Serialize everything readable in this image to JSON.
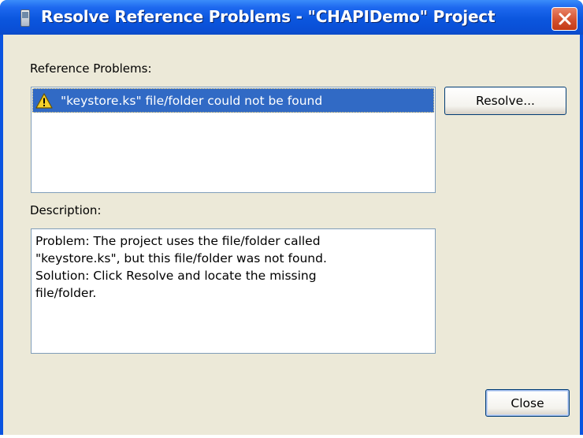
{
  "window": {
    "title": "Resolve Reference Problems - \"CHAPIDemo\" Project",
    "titlebar_color": "#0a54e0",
    "face_color": "#ece9d8"
  },
  "problems": {
    "label": "Reference Problems:",
    "items": [
      {
        "text": "\"keystore.ks\" file/folder could not be found",
        "icon": "warning-icon",
        "selected": true
      }
    ],
    "selection_color": "#316ac5"
  },
  "buttons": {
    "resolve": "Resolve...",
    "close": "Close"
  },
  "description": {
    "label": "Description:",
    "lines": [
      "Problem: The project uses the file/folder called",
      "\"keystore.ks\", but this file/folder was not found.",
      "Solution: Click Resolve and locate the missing",
      "file/folder."
    ]
  }
}
